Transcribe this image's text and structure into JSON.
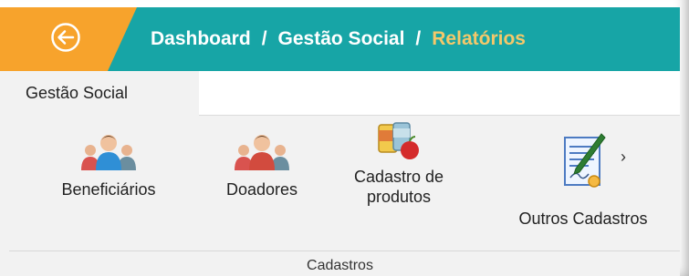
{
  "header": {
    "breadcrumb": [
      {
        "label": "Dashboard"
      },
      {
        "label": "Gestão Social"
      },
      {
        "label": "Relatórios"
      }
    ],
    "separator": "/",
    "colors": {
      "bar": "#17a5a6",
      "back_zone": "#f7a32c",
      "current_crumb": "#f5c86a"
    }
  },
  "tabs": [
    {
      "label": "Gestão Social",
      "active": true
    }
  ],
  "ribbon": {
    "items": [
      {
        "label": "Beneficiários",
        "icon": "people-group-icon"
      },
      {
        "label": "Doadores",
        "icon": "people-group-icon"
      },
      {
        "label": "Cadastro de\nprodutos",
        "icon": "food-products-icon"
      },
      {
        "label": "Outros Cadastros",
        "icon": "document-pen-icon"
      }
    ],
    "group_label": "Cadastros",
    "more_icon": "chevron-right-icon"
  }
}
